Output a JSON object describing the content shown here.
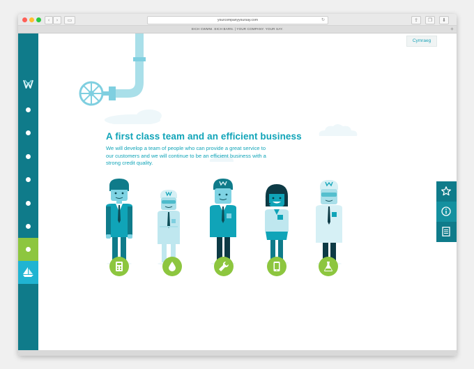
{
  "browser": {
    "url": "yourcompanyyoursay.com",
    "tab_title": "EICH CWMNI. EICH BARN. | YOUR COMPANY. YOUR SAY."
  },
  "page": {
    "language_toggle": "Cymraeg",
    "heading": "A first class team and an efficient business",
    "intro": "We will develop a team of people who can provide a great service to our customers and we will continue to be an efficient business with a strong credit quality."
  },
  "sidebar": {
    "logo": "ww-logo-icon",
    "dots": 7,
    "active_dot": 7,
    "bottom_icon": "sailboat-icon"
  },
  "right_tools": [
    "star-icon",
    "info-icon",
    "document-icon"
  ],
  "roles": [
    "calculator-icon",
    "water-drop-icon",
    "wrench-icon",
    "tablet-icon",
    "flask-icon"
  ],
  "colors": {
    "teal_dark": "#0f7b8a",
    "teal": "#10a4b8",
    "teal_light": "#20b4d2",
    "green": "#8dc63f"
  }
}
